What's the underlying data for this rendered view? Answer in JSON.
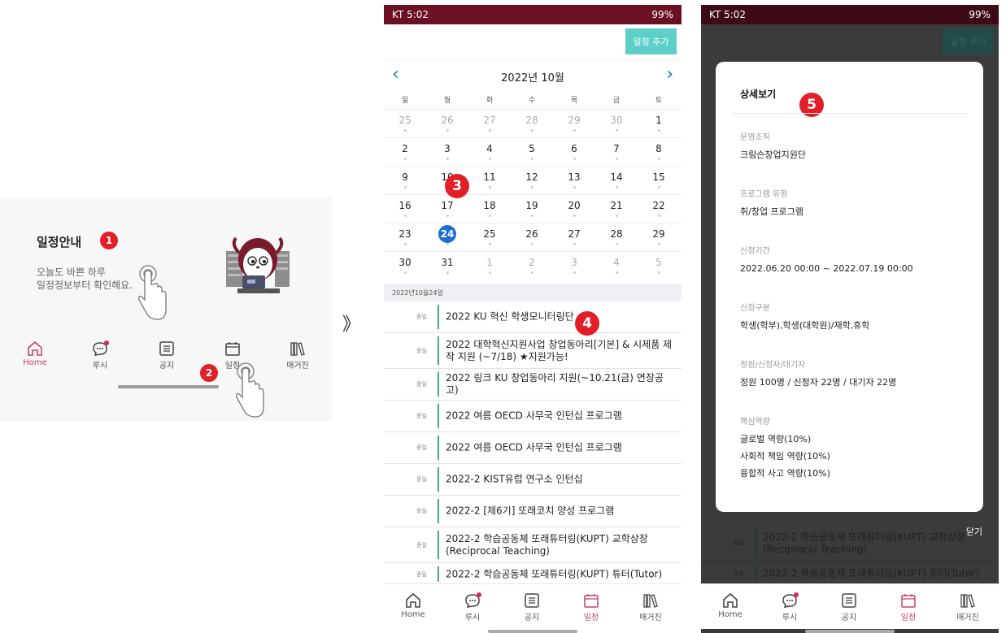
{
  "panel1": {
    "title": "일정안내",
    "badge1": "1",
    "sub_line1": "오늘도 바쁜 하루",
    "sub_line2": "일정정보부터 확인해요.",
    "badge2": "2",
    "tabs": [
      {
        "label": "Home",
        "icon": "home-icon"
      },
      {
        "label": "루시",
        "icon": "chat-icon"
      },
      {
        "label": "공지",
        "icon": "notice-icon"
      },
      {
        "label": "일정",
        "icon": "calendar-icon"
      },
      {
        "label": "매거진",
        "icon": "magazine-icon"
      }
    ]
  },
  "separator": "》",
  "panel2": {
    "status_left": "KT 5:02",
    "status_right": "99%",
    "add_button": "일정 추가",
    "month_label": "2022년 10월",
    "weekdays": [
      "일",
      "월",
      "화",
      "수",
      "목",
      "금",
      "토"
    ],
    "weeks": [
      [
        "25",
        "26",
        "27",
        "28",
        "29",
        "30",
        "1"
      ],
      [
        "2",
        "3",
        "4",
        "5",
        "6",
        "7",
        "8"
      ],
      [
        "9",
        "10",
        "11",
        "12",
        "13",
        "14",
        "15"
      ],
      [
        "16",
        "17",
        "18",
        "19",
        "20",
        "21",
        "22"
      ],
      [
        "23",
        "24",
        "25",
        "26",
        "27",
        "28",
        "29"
      ],
      [
        "30",
        "31",
        "1",
        "2",
        "3",
        "4",
        "5"
      ]
    ],
    "selected_day": "24",
    "badge3": "3",
    "date_header": "2022년10월24일",
    "badge4": "4",
    "event_tag": "종일",
    "events": [
      "2022 KU 혁신 학생모니터링단",
      "2022 대학혁신지원사업 창업동아리[기본] & 시제품 제작 지원 (~7/18) ★지원가능!",
      "2022 링크 KU 창업동아리 지원(~10.21(금) 연장공고)",
      "2022 여름 OECD 사무국 인턴십 프로그램",
      "2022 여름 OECD 사무국 인턴십 프로그램",
      "2022-2 KIST유럽 연구소 인턴십",
      "2022-2 [제6기] 또래코치 양성 프로그램",
      "2022-2 학습공동체 또래튜터링(KUPT) 교학상장 (Reciprocal Teaching)",
      "2022-2 학습공동체 또래튜터링(KUPT) 튜터(Tutor)"
    ],
    "tabs": [
      {
        "label": "Home",
        "icon": "home-icon"
      },
      {
        "label": "루시",
        "icon": "chat-icon"
      },
      {
        "label": "공지",
        "icon": "notice-icon"
      },
      {
        "label": "일정",
        "icon": "calendar-icon"
      },
      {
        "label": "매거진",
        "icon": "magazine-icon"
      }
    ]
  },
  "panel3": {
    "status_left": "KT 5:02",
    "status_right": "99%",
    "modal_title": "상세보기",
    "badge5": "5",
    "fields": [
      {
        "label": "운영조직",
        "value": "크림슨창업지원단"
      },
      {
        "label": "프로그램 유형",
        "value": "취/창업 프로그램"
      },
      {
        "label": "신청기간",
        "value": "2022.06.20 00:00 ~ 2022.07.19 00:00"
      },
      {
        "label": "신청구분",
        "value": "학생(학부),학생(대학원)/재학,휴학"
      },
      {
        "label": "정원/신청자/대기자",
        "value": "정원 100명 / 신청자 22명 / 대기자 22명"
      },
      {
        "label": "핵심역량",
        "value_lines": [
          "글로벌 역량(10%)",
          "사회적 책임 역량(10%)",
          "융합적 사고 역량(10%)"
        ]
      }
    ],
    "close_label": "닫기",
    "bg_add_button": "일정 추가",
    "bg_events": [
      "2022-2 학습공동체 또래튜터링(KUPT) 교학상장 (Reciprocal Teaching)",
      "2022-2 학습공동체 또래튜터링(KUPT) 튜터(Tutor)"
    ],
    "bg_event_tag": "종일",
    "tabs": [
      {
        "label": "Home",
        "icon": "home-icon"
      },
      {
        "label": "루시",
        "icon": "chat-icon"
      },
      {
        "label": "공지",
        "icon": "notice-icon"
      },
      {
        "label": "일정",
        "icon": "calendar-icon"
      },
      {
        "label": "매거진",
        "icon": "magazine-icon"
      }
    ]
  },
  "colors": {
    "status_bar": "#6a0f24",
    "accent_pink": "#c4446b",
    "badge_red": "#e21f26",
    "add_button": "#5ccfc9",
    "selected_day": "#1a6fd0",
    "event_bar": "#3fa98c"
  }
}
